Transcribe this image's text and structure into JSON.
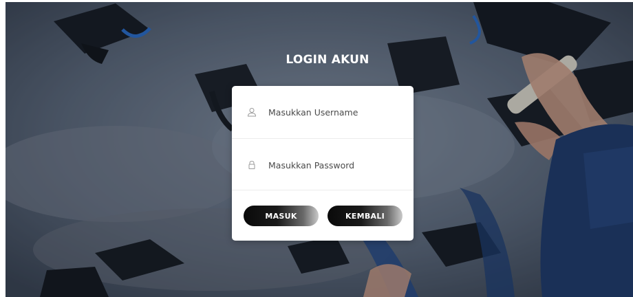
{
  "login": {
    "title": "LOGIN AKUN",
    "username_placeholder": "Masukkan Username",
    "password_placeholder": "Masukkan Password",
    "submit_label": "MASUK",
    "back_label": "KEMBALI"
  },
  "icons": {
    "username": "user-icon",
    "password": "lock-icon"
  },
  "background": {
    "image": "graduation-caps-thrown-in-sky"
  }
}
